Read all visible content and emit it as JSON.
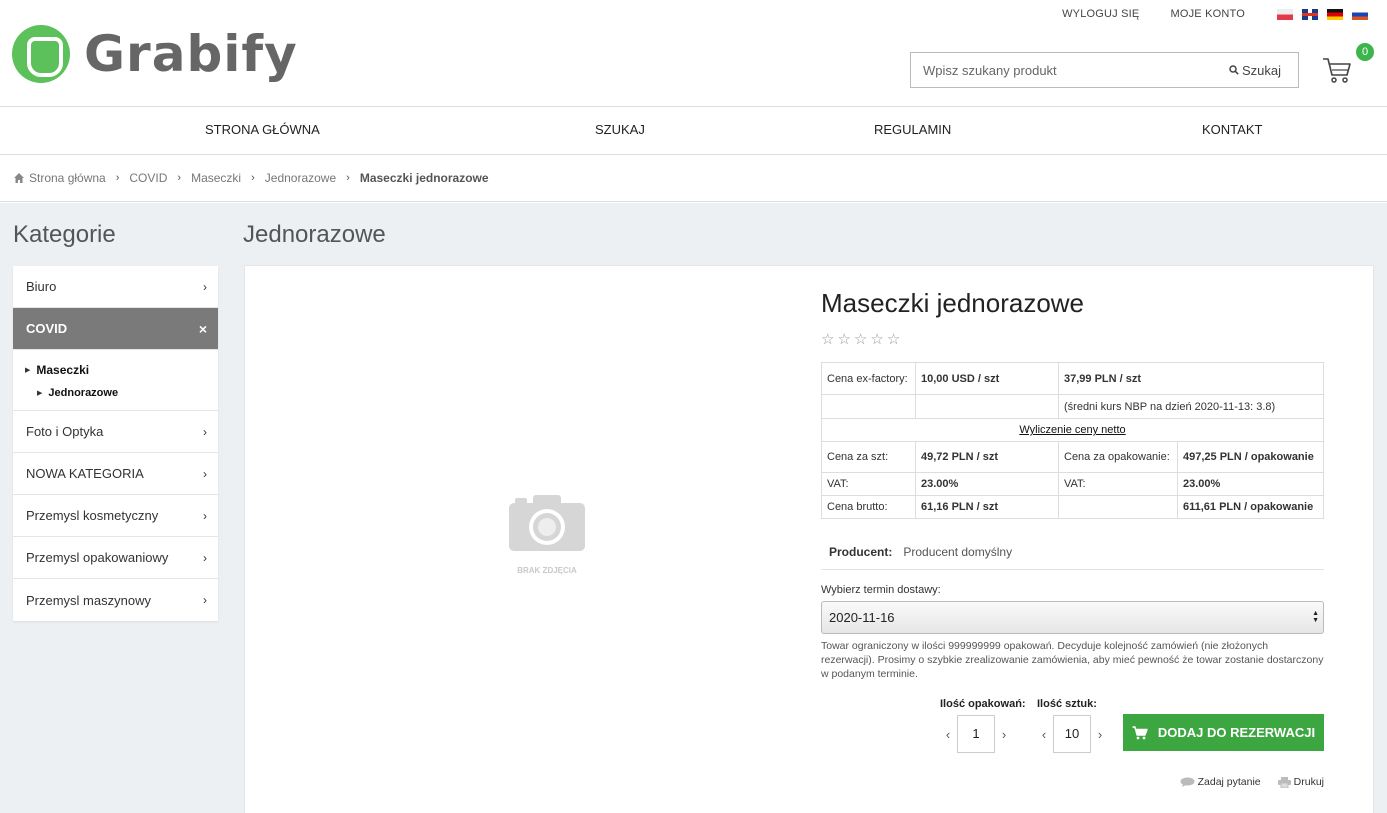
{
  "top_links": {
    "logout": "WYLOGUJ SIĘ",
    "account": "MOJE KONTO"
  },
  "flags": [
    "flag-pl-icon",
    "flag-en-icon",
    "flag-de-icon",
    "flag-ru-icon"
  ],
  "logo": {
    "text": "Grabify",
    "color": "#5cc15a"
  },
  "search": {
    "placeholder": "Wpisz szukany produkt",
    "button": "Szukaj"
  },
  "cart": {
    "count": "0",
    "badge_color": "#3cb54a"
  },
  "nav": {
    "home": "STRONA GŁÓWNA",
    "search": "SZUKAJ",
    "rules": "REGULAMIN",
    "contact": "KONTAKT"
  },
  "breadcrumb": {
    "home": "Strona główna",
    "items": [
      "COVID",
      "Maseczki",
      "Jednorazowe"
    ],
    "current": "Maseczki jednorazowe"
  },
  "sidebar": {
    "title": "Kategorie",
    "items": [
      "Biuro",
      "COVID",
      "Foto i Optyka",
      "NOWA KATEGORIA",
      "Przemysl kosmetyczny",
      "Przemysl opakowaniowy",
      "Przemysl maszynowy"
    ],
    "sub": {
      "level1": "Maseczki",
      "level2": "Jednorazowe"
    }
  },
  "content": {
    "title": "Jednorazowe"
  },
  "product": {
    "no_image": "BRAK ZDJĘCIA",
    "title": "Maseczki jednorazowe",
    "rating": {
      "value": 0,
      "max": 5
    },
    "price_table": {
      "exfactory_label": "Cena ex-factory:",
      "exfactory_usd": "10,00 USD / szt",
      "exfactory_pln": "37,99 PLN / szt",
      "rate_note_prefix": "(średni kurs NBP na dzień 2020-11-13: ",
      "rate_value": "3.8",
      "rate_note_suffix": ")",
      "net_link": "Wyliczenie ceny netto",
      "unit_label": "Cena za szt:",
      "unit_price": "49,72 PLN / szt",
      "pack_label": "Cena za opakowanie:",
      "pack_price": "497,25 PLN / opakowanie",
      "vat_label": "VAT:",
      "vat_value": "23.00%",
      "gross_label": "Cena brutto:",
      "gross_unit": "61,16 PLN / szt",
      "gross_pack": "611,61 PLN / opakowanie"
    },
    "producer_label": "Producent:",
    "producer_value": "Producent domyślny",
    "delivery_label": "Wybierz termin dostawy:",
    "delivery_value": "2020-11-16",
    "note": "Towar ograniczony w ilości 999999999 opakowań. Decyduje kolejność zamówień (nie złożonych rezerwacji). Prosimy o szybkie zrealizowanie zamówienia, aby mieć pewność że towar zostanie dostarczony w podanym terminie.",
    "qty_packs_label": "Ilość opakowań:",
    "qty_packs": "1",
    "qty_units_label": "Ilość sztuk:",
    "qty_units": "10",
    "add_button": "DODAJ DO REZERWACJI",
    "add_button_color": "#3ca640",
    "ask": "Zadaj pytanie",
    "print": "Drukuj"
  }
}
